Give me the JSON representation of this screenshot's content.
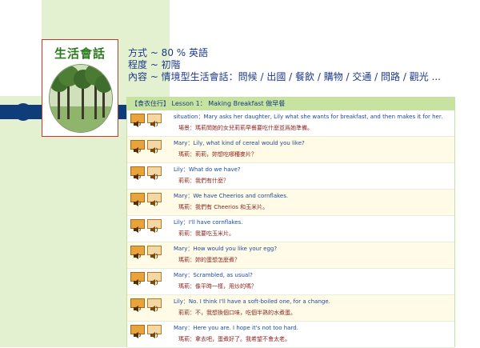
{
  "logo": {
    "title": "生活會話",
    "photo_icon": "trees-photo"
  },
  "info": {
    "line1": "方式 ~ 80 % 英語",
    "line2": "程度 ~ 初階",
    "line3": "內容 ~ 情境型生活會話：問候 / 出國 / 餐飲 / 購物 / 交通 / 問路 / 觀光 ..."
  },
  "lesson": {
    "header": "【食衣住行】 Lesson 1： Making Breakfast 做早餐",
    "rows": [
      {
        "line1": "situation：Mary asks her daughter, Lily what she wants for breakfast, and then makes it for her.",
        "line2": "場景：瑪莉問她的女兒莉莉早餐要吃什麼並爲她準備。"
      },
      {
        "line1": "Mary：Lily, what kind of cereal would you like?",
        "line2": "瑪莉：莉莉，妳想吃哪種麥片？"
      },
      {
        "line1": "Lily：What do we have?",
        "line2": "莉莉：我們有什麼？"
      },
      {
        "line1": "Mary：We have Cheerios and cornflakes.",
        "line2": "瑪莉：我們有 Cheerios 和玉米片。"
      },
      {
        "line1": "Lily：I'll have cornflakes.",
        "line2": "莉莉：我要吃玉米片。"
      },
      {
        "line1": "Mary：How would you like your egg?",
        "line2": "瑪莉：妳的蛋想怎麼煮？"
      },
      {
        "line1": "Mary：Scrambled, as usual?",
        "line2": "瑪莉：像平時一樣，用炒的嗎？"
      },
      {
        "line1": "Lily：No. I think I'll have a soft-boiled one, for a change.",
        "line2": "莉莉：不，我想換個口味，吃個半熟的水煮蛋。"
      },
      {
        "line1": "Mary：Here you are. I hope it's not too hard.",
        "line2": "瑪莉：拿去吧，蛋煮好了。我希望不會太老。"
      }
    ]
  },
  "colors": {
    "green_panel": "#e3f1d1",
    "navy": "#0f3d7a",
    "header_green": "#c7e3a0",
    "button_orange": "#e8a33a"
  },
  "icons": {
    "play": "speaker-play-icon",
    "repeat": "speaker-repeat-icon"
  }
}
